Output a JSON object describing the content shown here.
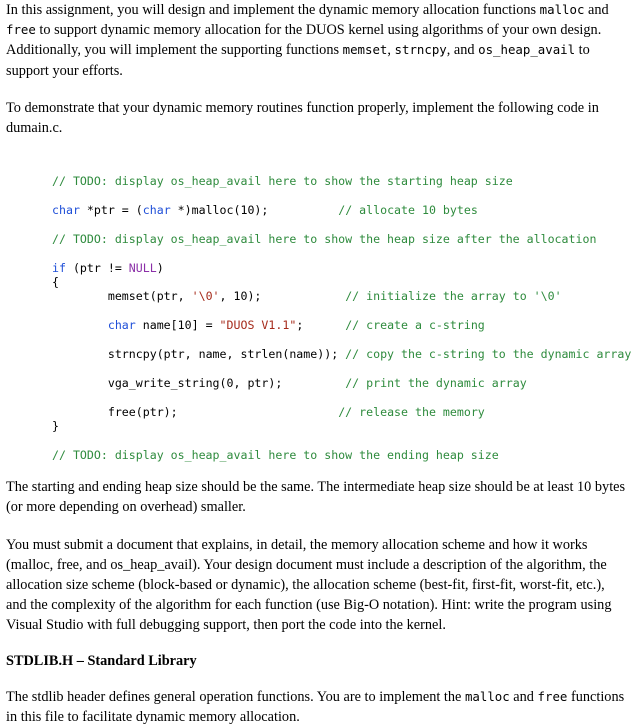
{
  "document": {
    "paragraphs": {
      "intro": {
        "seg1": "In this assignment, you will design and implement the dynamic memory allocation functions ",
        "code1": "malloc",
        "seg2": " and ",
        "code2": "free",
        "seg3": "  to support dynamic memory allocation for the DUOS kernel using algorithms of your own design.  Additionally, you will implement the supporting functions ",
        "code3": "memset",
        "seg4": ", ",
        "code4": "strncpy",
        "seg5": ", and ",
        "code5": "os_heap_avail",
        "seg6": " to support your efforts."
      },
      "demonstrate": "To demonstrate that your dynamic memory routines function properly, implement the following code in dumain.c.",
      "heapsize": "The starting and ending heap size should be the same.  The intermediate heap size should be at least 10 bytes (or more depending on overhead) smaller.",
      "submit": "You must submit a document that explains, in detail, the memory allocation scheme and how it works (malloc, free, and os_heap_avail).  Your design document must include a description of the algorithm, the allocation size scheme (block-based or dynamic), the allocation scheme (best-fit, first-fit, worst-fit, etc.), and the complexity of the algorithm for each function (use Big-O notation).  Hint:  write the program using Visual Studio with full debugging support, then port the code into the kernel.",
      "stdlib_heading": "STDLIB.H – Standard Library",
      "stdlib_body": {
        "seg1": "The stdlib header defines general operation functions.  You are to implement the ",
        "code1": "malloc",
        "seg2": " and ",
        "code2": "free",
        "seg3": " functions in this file to facilitate dynamic memory allocation."
      }
    },
    "code_listing": {
      "language": "c",
      "colors": {
        "comment": "#2e8b3d",
        "keyword": "#1f4fd8",
        "string": "#a52a1a",
        "constant": "#8b2fa8",
        "plain": "#000000"
      },
      "lines": [
        {
          "indent": 0,
          "tokens": [
            {
              "t": "cmt",
              "v": "// TODO: display os_heap_avail here to show the starting heap size"
            }
          ]
        },
        {
          "indent": 0,
          "tokens": []
        },
        {
          "indent": 0,
          "tokens": [
            {
              "t": "kw",
              "v": "char"
            },
            {
              "t": "plain",
              "v": " *ptr = ("
            },
            {
              "t": "kw",
              "v": "char"
            },
            {
              "t": "plain",
              "v": " *)malloc(10);"
            },
            {
              "t": "plain",
              "v": "          "
            },
            {
              "t": "cmt",
              "v": "// allocate 10 bytes"
            }
          ]
        },
        {
          "indent": 0,
          "tokens": []
        },
        {
          "indent": 0,
          "tokens": [
            {
              "t": "cmt",
              "v": "// TODO: display os_heap_avail here to show the heap size after the allocation"
            }
          ]
        },
        {
          "indent": 0,
          "tokens": []
        },
        {
          "indent": 0,
          "tokens": [
            {
              "t": "kw",
              "v": "if"
            },
            {
              "t": "plain",
              "v": " (ptr != "
            },
            {
              "t": "cnst",
              "v": "NULL"
            },
            {
              "t": "plain",
              "v": ")"
            }
          ]
        },
        {
          "indent": 0,
          "tokens": [
            {
              "t": "plain",
              "v": "{"
            }
          ]
        },
        {
          "indent": 1,
          "tokens": [
            {
              "t": "plain",
              "v": "memset(ptr, "
            },
            {
              "t": "str",
              "v": "'\\0'"
            },
            {
              "t": "plain",
              "v": ", 10);"
            },
            {
              "t": "plain",
              "v": "            "
            },
            {
              "t": "cmt",
              "v": "// initialize the array to '\\0'"
            }
          ]
        },
        {
          "indent": 1,
          "tokens": []
        },
        {
          "indent": 1,
          "tokens": [
            {
              "t": "kw",
              "v": "char"
            },
            {
              "t": "plain",
              "v": " name[10] = "
            },
            {
              "t": "str",
              "v": "\"DUOS V1.1\""
            },
            {
              "t": "plain",
              "v": ";"
            },
            {
              "t": "plain",
              "v": "      "
            },
            {
              "t": "cmt",
              "v": "// create a c-string"
            }
          ]
        },
        {
          "indent": 1,
          "tokens": []
        },
        {
          "indent": 1,
          "tokens": [
            {
              "t": "plain",
              "v": "strncpy(ptr, name, strlen(name)); "
            },
            {
              "t": "cmt",
              "v": "// copy the c-string to the dynamic array"
            }
          ]
        },
        {
          "indent": 1,
          "tokens": []
        },
        {
          "indent": 1,
          "tokens": [
            {
              "t": "plain",
              "v": "vga_write_string(0, ptr);"
            },
            {
              "t": "plain",
              "v": "         "
            },
            {
              "t": "cmt",
              "v": "// print the dynamic array"
            }
          ]
        },
        {
          "indent": 1,
          "tokens": []
        },
        {
          "indent": 1,
          "tokens": [
            {
              "t": "plain",
              "v": "free(ptr);"
            },
            {
              "t": "plain",
              "v": "                       "
            },
            {
              "t": "cmt",
              "v": "// release the memory"
            }
          ]
        },
        {
          "indent": 0,
          "tokens": [
            {
              "t": "plain",
              "v": "}"
            }
          ]
        },
        {
          "indent": 0,
          "tokens": []
        },
        {
          "indent": 0,
          "tokens": [
            {
              "t": "cmt",
              "v": "// TODO: display os_heap_avail here to show the ending heap size"
            }
          ]
        }
      ]
    }
  }
}
